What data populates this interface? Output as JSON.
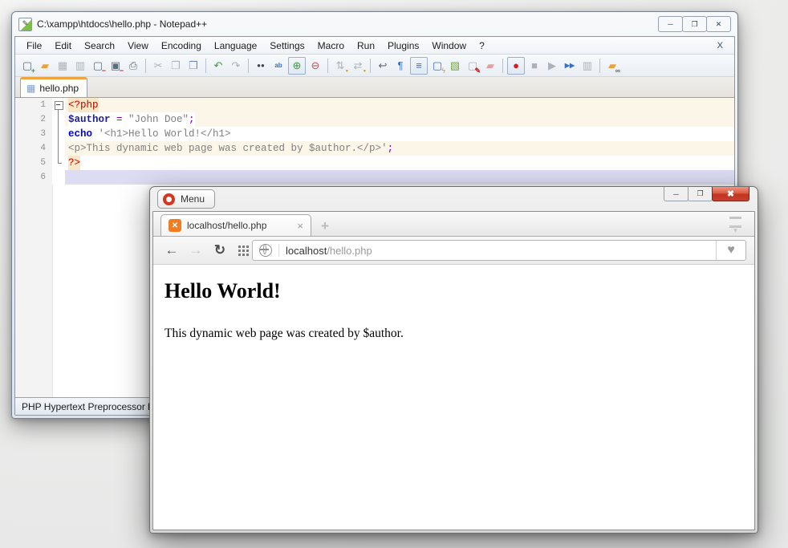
{
  "colors": {
    "tab_accent": "#f0a23c",
    "xampp_orange": "#f47c20",
    "opera_close": "#c8402f",
    "php_tag": "#cc0000",
    "php_variable": "#202090",
    "php_keyword": "#0000e0",
    "php_string": "#808080",
    "php_operator": "#8000c0",
    "line_cream": "#fbf6e8",
    "line_current": "#dcdcf2",
    "chip_peach": "#f8e8c8"
  },
  "npp": {
    "title": "C:\\xampp\\htdocs\\hello.php - Notepad++",
    "controls": {
      "min": "─",
      "max": "❐",
      "close": "✕"
    },
    "menu": [
      "File",
      "Edit",
      "Search",
      "View",
      "Encoding",
      "Language",
      "Settings",
      "Macro",
      "Run",
      "Plugins",
      "Window",
      "?"
    ],
    "menu_close": "X",
    "toolbar": {
      "icons": [
        {
          "name": "new-file",
          "g": "▢",
          "b": "+"
        },
        {
          "name": "open-file",
          "g": "▰",
          "b": ""
        },
        {
          "name": "save",
          "g": "▦",
          "b": ""
        },
        {
          "name": "save-all",
          "g": "▥",
          "b": ""
        },
        {
          "name": "close-file",
          "g": "▢",
          "b": "−"
        },
        {
          "name": "close-all",
          "g": "▣",
          "b": "−"
        },
        {
          "name": "print",
          "g": "⎙",
          "b": ""
        },
        {
          "name": "cut",
          "g": "✂",
          "b": ""
        },
        {
          "name": "copy",
          "g": "❐",
          "b": ""
        },
        {
          "name": "paste",
          "g": "❒",
          "b": ""
        },
        {
          "name": "undo",
          "g": "↶",
          "b": ""
        },
        {
          "name": "redo",
          "g": "↷",
          "b": ""
        },
        {
          "name": "find",
          "g": "●●",
          "b": ""
        },
        {
          "name": "replace",
          "g": "ab",
          "b": ""
        },
        {
          "name": "zoom-in",
          "g": "⊕",
          "b": ""
        },
        {
          "name": "zoom-out",
          "g": "⊖",
          "b": ""
        },
        {
          "name": "sync-scroll-v",
          "g": "⇅",
          "b": "▪"
        },
        {
          "name": "sync-scroll-h",
          "g": "⇄",
          "b": "▪"
        },
        {
          "name": "word-wrap",
          "g": "↩",
          "b": ""
        },
        {
          "name": "show-all-characters",
          "g": "¶",
          "b": ""
        },
        {
          "name": "indent-guide",
          "g": "≡",
          "b": ""
        },
        {
          "name": "function-list",
          "g": "▢",
          "b": "ϟ"
        },
        {
          "name": "document-map",
          "g": "▧",
          "b": ""
        },
        {
          "name": "document-switcher",
          "g": "▢",
          "b": "✎"
        },
        {
          "name": "folder-as-workspace",
          "g": "▰",
          "b": ""
        },
        {
          "name": "macro-record",
          "g": "●",
          "b": ""
        },
        {
          "name": "macro-stop",
          "g": "■",
          "b": ""
        },
        {
          "name": "macro-play",
          "g": "▶",
          "b": ""
        },
        {
          "name": "macro-run-multiple",
          "g": "▶▶",
          "b": ""
        },
        {
          "name": "macro-save",
          "g": "▥",
          "b": ""
        },
        {
          "name": "open-folder-link",
          "g": "▰",
          "b": "∞"
        }
      ]
    },
    "tab": {
      "label": "hello.php",
      "icon": "▦"
    },
    "code": {
      "lines": [
        {
          "num": "1",
          "segments": [
            {
              "t": "<?php"
            }
          ]
        },
        {
          "num": "2",
          "segments": [
            {
              "t": "$author"
            },
            {
              "t": " = "
            },
            {
              "t": "\"John Doe\""
            },
            {
              "t": ";"
            }
          ]
        },
        {
          "num": "3",
          "segments": [
            {
              "t": "echo"
            },
            {
              "t": " "
            },
            {
              "t": "'<h1>Hello World!</h1>"
            }
          ]
        },
        {
          "num": "4",
          "segments": [
            {
              "t": "<p>This dynamic web page was created by $author.</p>'"
            },
            {
              "t": ";"
            }
          ]
        },
        {
          "num": "5",
          "segments": [
            {
              "t": "?>"
            }
          ]
        },
        {
          "num": "6",
          "segments": []
        }
      ]
    },
    "status": "PHP Hypertext Preprocessor le"
  },
  "opera": {
    "menu_label": "Menu",
    "controls": {
      "min": "─",
      "max": "❐",
      "close": "✖"
    },
    "tab": {
      "label": "localhost/hello.php",
      "close": "×"
    },
    "new_tab": "+",
    "nav": {
      "back": "←",
      "forward": "→",
      "reload": "↻"
    },
    "address": {
      "host": "localhost",
      "path": "/hello.php",
      "heart": "♥"
    },
    "page": {
      "heading": "Hello World!",
      "paragraph": "This dynamic web page was created by $author."
    }
  }
}
